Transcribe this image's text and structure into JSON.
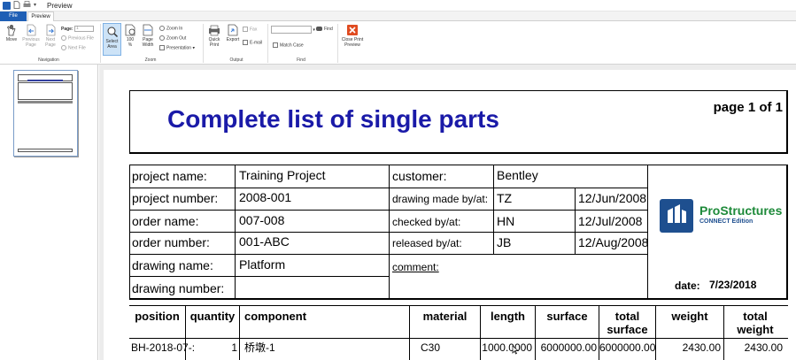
{
  "window": {
    "title": "Preview"
  },
  "tabs": [
    {
      "label": "File"
    },
    {
      "label": "Preview"
    }
  ],
  "ribbon": {
    "navigation": {
      "move": "Move",
      "previous_page": [
        "Previous",
        "Page"
      ],
      "next_page": [
        "Next",
        "Page"
      ],
      "page_label": "Page:",
      "page_value": "1",
      "previous_file": "Previous File",
      "next_file": "Next File",
      "group": "Navigation"
    },
    "zoom": {
      "select_area": [
        "Select",
        "Area"
      ],
      "hundred": [
        "100",
        "%"
      ],
      "page_width": [
        "Page",
        "Width"
      ],
      "zoom_in": "Zoom In",
      "zoom_out": "Zoom Out",
      "presentation": "Presentation",
      "group": "Zoom"
    },
    "output": {
      "quick_print": [
        "Quick",
        "Print"
      ],
      "export": "Export",
      "fax": "Fax",
      "email": "E-mail",
      "group": "Output"
    },
    "find": {
      "find": "Find",
      "match_case": "Match Case",
      "group": "Find"
    },
    "close": [
      "Close Print",
      "Preview"
    ]
  },
  "report": {
    "title": "Complete list of single parts",
    "page_of": "page 1 of 1",
    "info": {
      "project_name_label": "project name:",
      "project_name": "Training Project",
      "project_number_label": "project number:",
      "project_number": "2008-001",
      "order_name_label": "order name:",
      "order_name": "007-008",
      "order_number_label": "order number:",
      "order_number": "001-ABC",
      "drawing_name_label": "drawing name:",
      "drawing_name": "Platform",
      "drawing_number_label": "drawing number:",
      "drawing_number": "",
      "customer_label": "customer:",
      "customer": "Bentley",
      "drawing_made_label": "drawing made by/at:",
      "drawing_made_by": "TZ",
      "drawing_made_at": "12/Jun/2008",
      "checked_label": "checked by/at:",
      "checked_by": "HN",
      "checked_at": "12/Jul/2008",
      "released_label": "released by/at:",
      "released_by": "JB",
      "released_at": "12/Aug/2008",
      "comment_label": "comment:",
      "date_label": "date:",
      "date": "7/23/2018"
    },
    "logo": {
      "name": "ProStructures",
      "sub": "CONNECT Edition"
    },
    "columns": {
      "position": "position",
      "quantity": "quantity",
      "component": "component",
      "material": "material",
      "length": "length",
      "surface": "surface",
      "total_surface": [
        "total",
        "surface"
      ],
      "weight": "weight",
      "total_weight": [
        "total",
        "weight"
      ]
    },
    "rows": [
      {
        "position": "BH-2018-07-:",
        "quantity": "1",
        "component": "桥墩-1",
        "material": "C30",
        "length": "1000.0000",
        "surface": "6000000.00",
        "total_surface": "6000000.00",
        "weight": "2430.00",
        "total_weight": "2430.00"
      }
    ]
  },
  "colors": {
    "title_blue": "#1a1aa8",
    "file_tab": "#1f5fb5",
    "logo_green": "#1e8a3a",
    "logo_blue": "#1e4f8f",
    "close_red": "#e04b20"
  }
}
